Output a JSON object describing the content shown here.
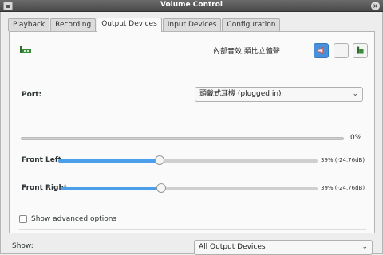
{
  "window": {
    "title": "Volume Control",
    "close_glyph": "×"
  },
  "tabs": [
    {
      "label": "Playback",
      "active": false
    },
    {
      "label": "Recording",
      "active": false
    },
    {
      "label": "Output Devices",
      "active": true
    },
    {
      "label": "Input Devices",
      "active": false
    },
    {
      "label": "Configuration",
      "active": false
    }
  ],
  "device": {
    "name": "內部音效 類比立體聲",
    "icon": "sound-card-icon",
    "buttons": {
      "mute": "speaker-mute-icon",
      "lock": "lock-channels-icon",
      "default": "set-default-icon"
    }
  },
  "port": {
    "label": "Port:",
    "value": "頭戴式耳機 (plugged in)"
  },
  "master": {
    "value_text": "0%",
    "level": 0
  },
  "channels": [
    {
      "label": "Front Left",
      "value_text": "39% (-24.76dB)",
      "level": 0.39
    },
    {
      "label": "Front Right",
      "value_text": "39% (-24.76dB)",
      "level": 0.39
    }
  ],
  "advanced": {
    "label": "Show advanced options",
    "checked": false
  },
  "show": {
    "label": "Show:",
    "value": "All Output Devices"
  },
  "colors": {
    "accent": "#4a9eea",
    "titlebar": "#555555"
  }
}
